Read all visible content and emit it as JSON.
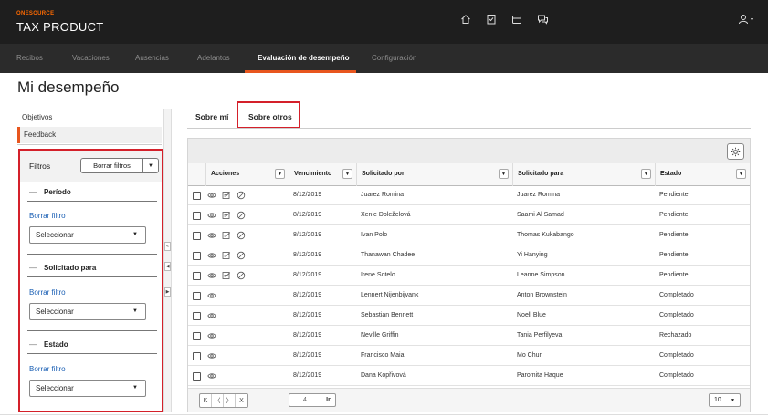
{
  "header": {
    "brand_small": "ONESOURCE",
    "brand_big": "TAX PRODUCT",
    "icons": [
      "home-icon",
      "checklist-icon",
      "wallet-icon",
      "chat-icon"
    ],
    "user_icon": "user-icon"
  },
  "nav": {
    "items": [
      "Recibos",
      "Vacaciones",
      "Ausencias",
      "Adelantos",
      "Evaluación de desempeño",
      "Configuración"
    ],
    "active_index": 4
  },
  "page": {
    "title": "Mi desempeño"
  },
  "sidebar": {
    "items": [
      "Objetivos",
      "Feedback"
    ],
    "active_index": 1
  },
  "filters": {
    "title": "Filtros",
    "clear_all_label": "Borrar filtros",
    "sections": [
      {
        "title": "Período",
        "clear_label": "Borrar filtro",
        "select_value": "Seleccionar"
      },
      {
        "title": "Solicitado para",
        "clear_label": "Borrar filtro",
        "select_value": "Seleccionar"
      },
      {
        "title": "Estado",
        "clear_label": "Borrar filtro",
        "select_value": "Seleccionar"
      }
    ]
  },
  "tabs": {
    "items": [
      "Sobre mí",
      "Sobre otros"
    ],
    "active_index": 1
  },
  "grid": {
    "columns": [
      "Acciones",
      "Vencimiento",
      "Solicitado por",
      "Solicitado para",
      "Estado"
    ],
    "rows": [
      {
        "actions": [
          "eye",
          "edit",
          "block"
        ],
        "due": "8/12/2019",
        "by": "Juarez Romina",
        "for": "Juarez Romina",
        "status": "Pendiente"
      },
      {
        "actions": [
          "eye",
          "edit",
          "block"
        ],
        "due": "8/12/2019",
        "by": "Xenie Doleželová",
        "for": "Saami Al Samad",
        "status": "Pendiente"
      },
      {
        "actions": [
          "eye",
          "edit",
          "block"
        ],
        "due": "8/12/2019",
        "by": "Ivan Polo",
        "for": "Thomas Kukabango",
        "status": "Pendiente"
      },
      {
        "actions": [
          "eye",
          "edit",
          "block"
        ],
        "due": "8/12/2019",
        "by": "Thanawan Chadee",
        "for": "Yi Hanying",
        "status": "Pendiente"
      },
      {
        "actions": [
          "eye",
          "edit",
          "block"
        ],
        "due": "8/12/2019",
        "by": "Irene Sotelo",
        "for": "Leanne Simpson",
        "status": "Pendiente"
      },
      {
        "actions": [
          "eye"
        ],
        "due": "8/12/2019",
        "by": "Lennert Nijenbijvank",
        "for": "Anton Brownstein",
        "status": "Completado"
      },
      {
        "actions": [
          "eye"
        ],
        "due": "8/12/2019",
        "by": "Sebastian Bennett",
        "for": "Noell Blue",
        "status": "Completado"
      },
      {
        "actions": [
          "eye"
        ],
        "due": "8/12/2019",
        "by": "Neville Griffin",
        "for": "Tania Perfilyeva",
        "status": "Rechazado"
      },
      {
        "actions": [
          "eye"
        ],
        "due": "8/12/2019",
        "by": "Francisco Maia",
        "for": "Mo Chun",
        "status": "Completado"
      },
      {
        "actions": [
          "eye"
        ],
        "due": "8/12/2019",
        "by": "Dana Kopřivová",
        "for": "Paromita Haque",
        "status": "Completado"
      }
    ]
  },
  "pager": {
    "first": "K",
    "prev": "〈",
    "next": "〉",
    "last": "X",
    "page_value": "4",
    "go_label": "Ir",
    "page_size": "10"
  },
  "colors": {
    "accent": "#e8561e",
    "highlight": "#d4202a",
    "header_bg": "#1e1e1e",
    "nav_bg": "#2b2b2b",
    "link": "#1a5fb4"
  }
}
